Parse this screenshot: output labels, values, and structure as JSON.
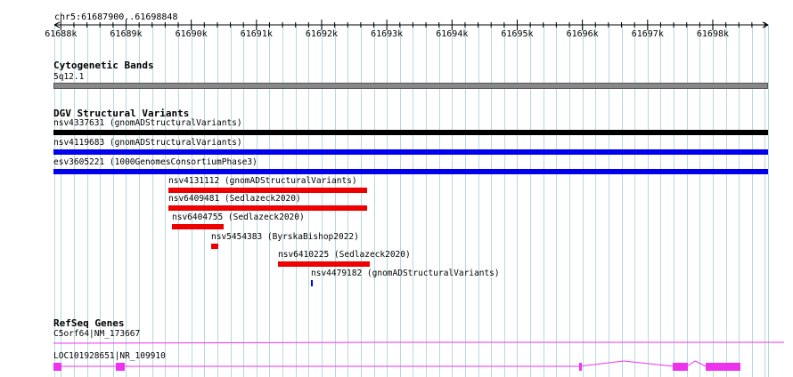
{
  "location": "chr5:61687900..61698848",
  "ruler": {
    "start": 61687900,
    "end": 61698848,
    "ticks": [
      "61688k",
      "61689k",
      "61690k",
      "61691k",
      "61692k",
      "61693k",
      "61694k",
      "61695k",
      "61696k",
      "61697k",
      "61698k"
    ]
  },
  "cytobands": {
    "title": "Cytogenetic Bands",
    "band": "5q12.1"
  },
  "dgv": {
    "title": "DGV Structural Variants",
    "variants": [
      {
        "label": "nsv4337631 (gnomADStructuralVariants)",
        "start": 61687900,
        "end": 61698848,
        "color": "#000000"
      },
      {
        "label": "nsv4119683 (gnomADStructuralVariants)",
        "start": 61687900,
        "end": 61698848,
        "color": "#0000ee"
      },
      {
        "label": "esv3605221 (1000GenomesConsortiumPhase3)",
        "start": 61687900,
        "end": 61698848,
        "color": "#0000ee"
      },
      {
        "label": "nsv4131112 (gnomADStructuralVariants)",
        "start": 61689650,
        "end": 61692700,
        "color": "#ee0000"
      },
      {
        "label": "nsv6409481 (Sedlazeck2020)",
        "start": 61689650,
        "end": 61692700,
        "color": "#ee0000"
      },
      {
        "label": "nsv6404755 (Sedlazeck2020)",
        "start": 61689700,
        "end": 61690500,
        "color": "#ee0000"
      },
      {
        "label": "nsv5454383 (ByrskaBishop2022)",
        "start": 61690300,
        "end": 61690410,
        "color": "#ee0000"
      },
      {
        "label": "nsv6410225 (Sedlazeck2020)",
        "start": 61691330,
        "end": 61692740,
        "color": "#ee0000"
      },
      {
        "label": "nsv4479182 (gnomADStructuralVariants)",
        "start": 61691840,
        "end": 61691870,
        "color": "#0000ee"
      }
    ]
  },
  "refseq": {
    "title": "RefSeq Genes",
    "genes": [
      {
        "label": "C5orf64|NM_173667",
        "color": "#ee33ee"
      },
      {
        "label": "LOC101928651|NR_109910",
        "color": "#ee33ee"
      }
    ]
  }
}
